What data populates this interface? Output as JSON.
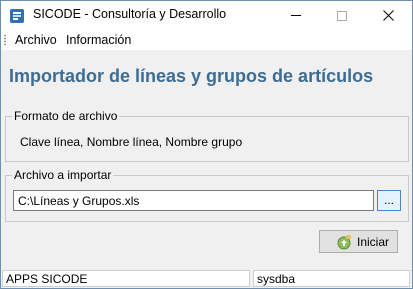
{
  "window": {
    "title": "SICODE - Consultoría y Desarrollo"
  },
  "menu": {
    "items": [
      {
        "label": "Archivo"
      },
      {
        "label": "Información"
      }
    ]
  },
  "header": {
    "title": "Importador de líneas y grupos de artículos"
  },
  "format_group": {
    "legend": "Formato de archivo",
    "description": "Clave línea, Nombre línea, Nombre grupo"
  },
  "file_group": {
    "legend": "Archivo a importar",
    "file_path": "C:\\Líneas y Grupos.xls",
    "browse_label": "..."
  },
  "actions": {
    "start_label": "Iniciar"
  },
  "status": {
    "app": "APPS SICODE",
    "user": "sysdba"
  },
  "colors": {
    "title_accent": "#3d6d95",
    "browse_border": "#4a86c8"
  }
}
